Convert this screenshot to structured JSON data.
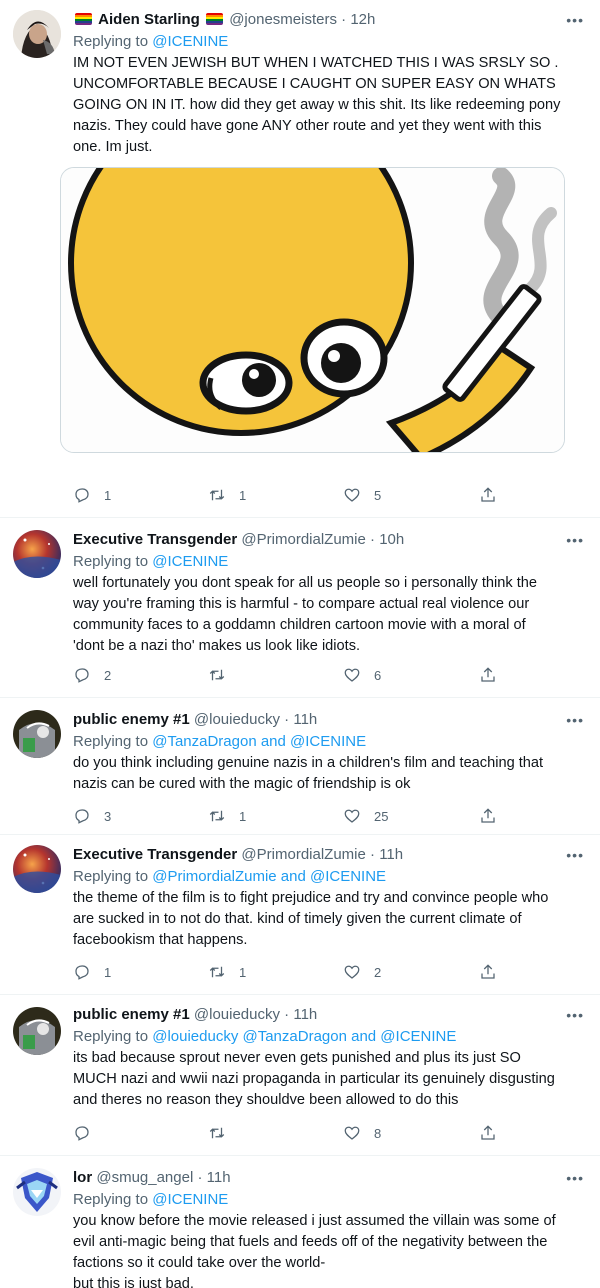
{
  "tweets": [
    {
      "name": "Aiden Starling",
      "handle": "@jonesmeisters",
      "dot": "·",
      "time": "12h",
      "replying_prefix": "Replying to",
      "replying_to": "@ICENINE",
      "text_lines": [
        "IM NOT EVEN JEWISH BUT WHEN I WATCHED THIS I WAS SRSLY SO .",
        "UNCOMFORTABLE BECAUSE I CAUGHT ON SUPER EASY ON WHATS",
        "GOING ON IN IT. how did they get away w this shit. Its like redeeming pony",
        "nazis. They could have gone ANY other route and yet they went with this",
        "one. Im just."
      ],
      "replies": "1",
      "retweets": "1",
      "likes": "5",
      "has_media": true
    },
    {
      "name": "Executive Transgender",
      "handle": "@PrimordialZumie",
      "dot": "·",
      "time": "10h",
      "replying_prefix": "Replying to",
      "replying_to": "@ICENINE",
      "text_lines": [
        "well fortunately you dont speak for all us people so i personally think the",
        "way you're framing this is harmful - to compare actual real violence our",
        "community faces to a goddamn children cartoon movie with a moral of",
        "'dont be a nazi tho' makes us look like idiots."
      ],
      "replies": "2",
      "retweets": "",
      "likes": "6"
    },
    {
      "name": "public enemy #1",
      "handle": "@louieducky",
      "dot": "·",
      "time": "11h",
      "replying_prefix": "Replying to",
      "replying_to": "@TanzaDragon and @ICENINE",
      "text_lines": [
        "do you think including genuine nazis in a children's film and teaching that",
        "nazis can be cured with the magic of friendship is ok"
      ],
      "replies": "3",
      "retweets": "1",
      "likes": "25"
    },
    {
      "name": "Executive Transgender",
      "handle": "@PrimordialZumie",
      "dot": "·",
      "time": "11h",
      "replying_prefix": "Replying to",
      "replying_to": "@PrimordialZumie and @ICENINE",
      "text_lines": [
        "the theme of the film is to fight prejudice and try and convince people who",
        "are sucked in to not do that. kind of timely given the current climate of",
        "facebookism that happens."
      ],
      "replies": "1",
      "retweets": "1",
      "likes": "2"
    },
    {
      "name": "public enemy #1",
      "handle": "@louieducky",
      "dot": "·",
      "time": "11h",
      "replying_prefix": "Replying to",
      "replying_to": "@louieducky @TanzaDragon and @ICENINE",
      "text_lines": [
        "its bad because sprout never even gets punished and plus its just SO",
        "MUCH nazi and wwii nazi propaganda in particular its genuinely disgusting",
        "and theres no reason they shouldve been allowed to do this"
      ],
      "replies": "",
      "retweets": "",
      "likes": "8"
    },
    {
      "name": "lor",
      "handle": "@smug_angel",
      "dot": "·",
      "time": "11h",
      "replying_prefix": "Replying to",
      "replying_to": "@ICENINE",
      "text_lines": [
        "you know before the movie released i just assumed the villain was some of",
        "evil anti-magic being that fuels and feeds off of the negativity between the",
        "factions so it could take over the world-",
        "but this is just bad."
      ]
    }
  ],
  "more_label": "•••",
  "colors": {
    "text": "#0f1419",
    "secondary": "#536471",
    "link": "#1d9bf0",
    "divider": "#eff3f4"
  },
  "icons": [
    "reply-icon",
    "retweet-icon",
    "like-icon",
    "share-icon",
    "more-icon"
  ]
}
